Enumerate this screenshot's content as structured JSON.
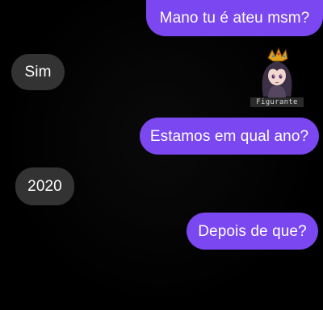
{
  "colors": {
    "sent_bubble": "#7b47f0",
    "received_bubble": "#333333",
    "background": "#000000",
    "text": "#ffffff"
  },
  "messages": [
    {
      "direction": "sent",
      "text": "Mano tu é ateu msm?"
    },
    {
      "direction": "received",
      "text": "Sim"
    },
    {
      "direction": "sent",
      "text": "Estamos em qual ano?"
    },
    {
      "direction": "received",
      "text": "2020"
    },
    {
      "direction": "sent",
      "text": "Depois de que?"
    }
  ],
  "sticker": {
    "icon": "crowned-anime-girl-icon",
    "caption": "Figurante"
  }
}
